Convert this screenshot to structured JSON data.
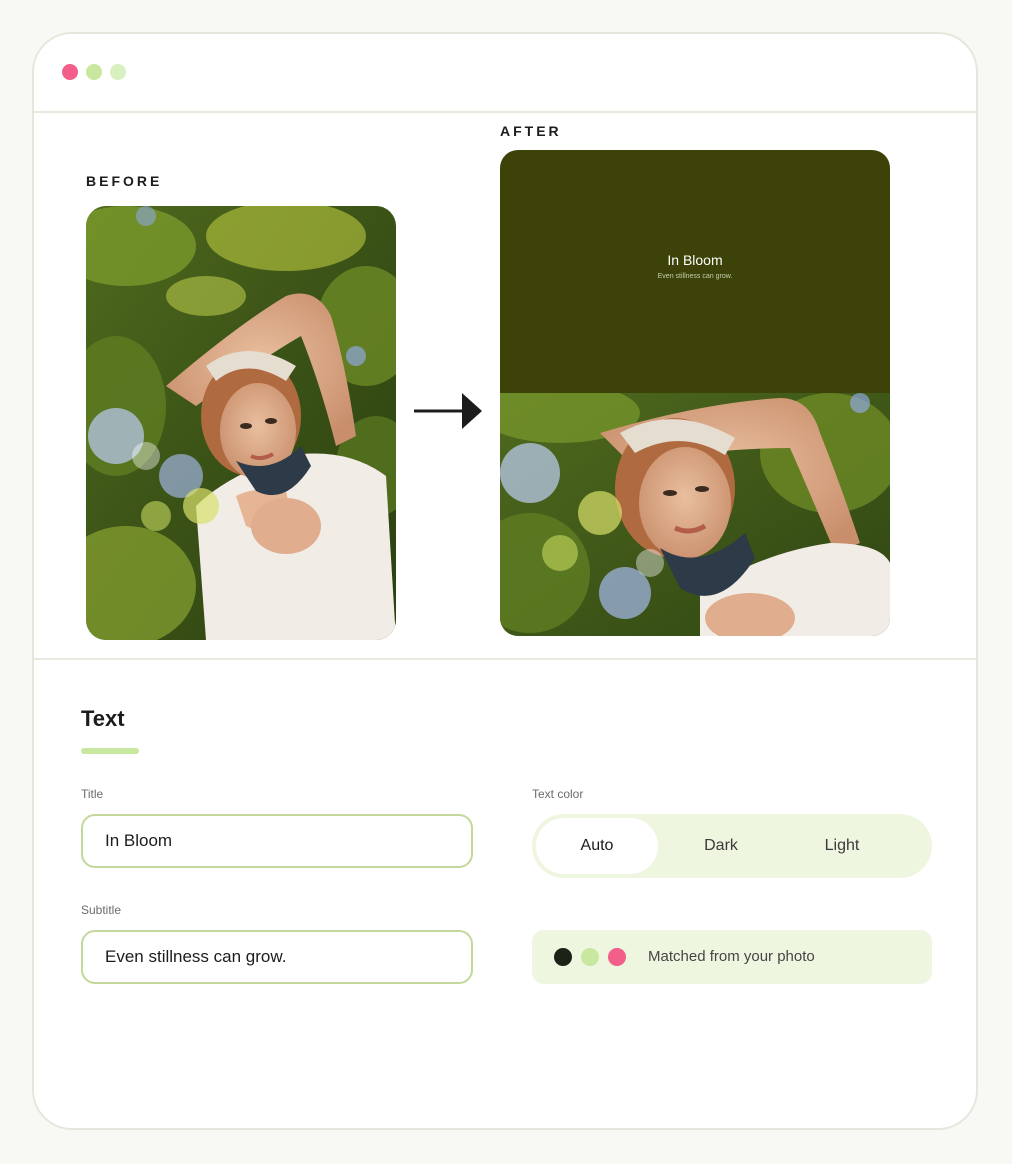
{
  "window": {
    "traffic_lights": [
      "#f25f8a",
      "#c8e8a0",
      "#d8efbf"
    ]
  },
  "preview": {
    "before_label": "BEFORE",
    "after_label": "AFTER",
    "arrow_icon": "arrow-right-icon",
    "after_card": {
      "background": "#3c4208",
      "title": "In Bloom",
      "subtitle": "Even stillness can grow."
    }
  },
  "text_panel": {
    "heading": "Text",
    "accent": "#c8e8a0",
    "title_field": {
      "label": "Title",
      "value": "In Bloom"
    },
    "subtitle_field": {
      "label": "Subtitle",
      "value": "Even stillness can grow."
    },
    "text_color": {
      "label": "Text color",
      "options": [
        "Auto",
        "Dark",
        "Light"
      ],
      "selected": "Auto"
    },
    "matched": {
      "swatches": [
        "#1d2216",
        "#c8e8a0",
        "#f25f8a"
      ],
      "label": "Matched from your photo"
    }
  },
  "colors": {
    "input_border": "#c3d89a",
    "segment_bg": "#eef6e0",
    "matched_bg": "#eef6e0"
  }
}
